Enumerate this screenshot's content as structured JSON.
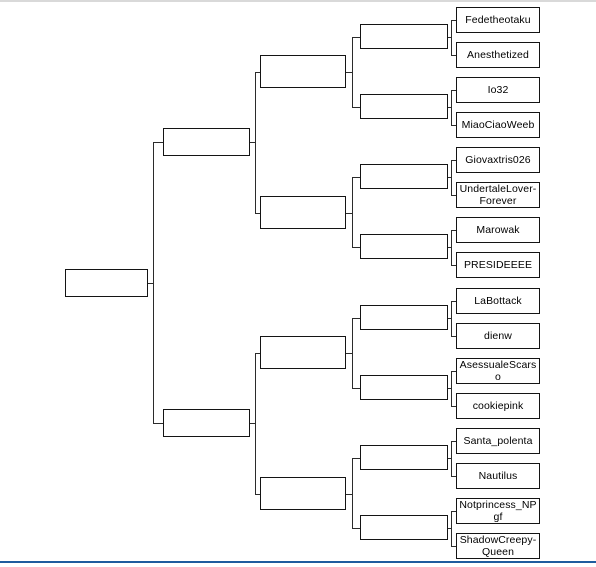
{
  "page": {
    "title": "Tournament Bracket",
    "layout": "right-to-left single elimination",
    "rounds": 5,
    "participant_count": 16
  },
  "colors": {
    "box_border": "#141414",
    "connector": "#2b2b2b",
    "top_rule": "#d9d9d9",
    "bottom_rule": "#1f5c9e",
    "background": "#ffffff",
    "text": "#000000"
  },
  "bracket": {
    "round_labels": [],
    "participants": [
      {
        "id": "p1",
        "name": "Fedetheotaku"
      },
      {
        "id": "p2",
        "name": "Anesthetized"
      },
      {
        "id": "p3",
        "name": "Io32"
      },
      {
        "id": "p4",
        "name": "MiaoCiaoWeeb"
      },
      {
        "id": "p5",
        "name": "Giovaxtris026"
      },
      {
        "id": "p6",
        "name": "UndertaleLover-Forever"
      },
      {
        "id": "p7",
        "name": "Marowak"
      },
      {
        "id": "p8",
        "name": "PRESIDEEEE"
      },
      {
        "id": "p9",
        "name": "LaBottack"
      },
      {
        "id": "p10",
        "name": "dienw"
      },
      {
        "id": "p11",
        "name": "AsessualeScarso"
      },
      {
        "id": "p12",
        "name": "cookiepink"
      },
      {
        "id": "p13",
        "name": "Santa_polenta"
      },
      {
        "id": "p14",
        "name": "Nautilus"
      },
      {
        "id": "p15",
        "name": "Notprincess_NPgf"
      },
      {
        "id": "p16",
        "name": "ShadowCreepy-Queen"
      }
    ],
    "round_of_8": [
      {
        "id": "r8-1",
        "name": ""
      },
      {
        "id": "r8-2",
        "name": ""
      },
      {
        "id": "r8-3",
        "name": ""
      },
      {
        "id": "r8-4",
        "name": ""
      },
      {
        "id": "r8-5",
        "name": ""
      },
      {
        "id": "r8-6",
        "name": ""
      },
      {
        "id": "r8-7",
        "name": ""
      },
      {
        "id": "r8-8",
        "name": ""
      }
    ],
    "quarter_finals": [
      {
        "id": "qf-1",
        "name": ""
      },
      {
        "id": "qf-2",
        "name": ""
      },
      {
        "id": "qf-3",
        "name": ""
      },
      {
        "id": "qf-4",
        "name": ""
      }
    ],
    "semi_finals": [
      {
        "id": "sf-1",
        "name": ""
      },
      {
        "id": "sf-2",
        "name": ""
      }
    ],
    "final": {
      "id": "final-1",
      "name": ""
    }
  }
}
